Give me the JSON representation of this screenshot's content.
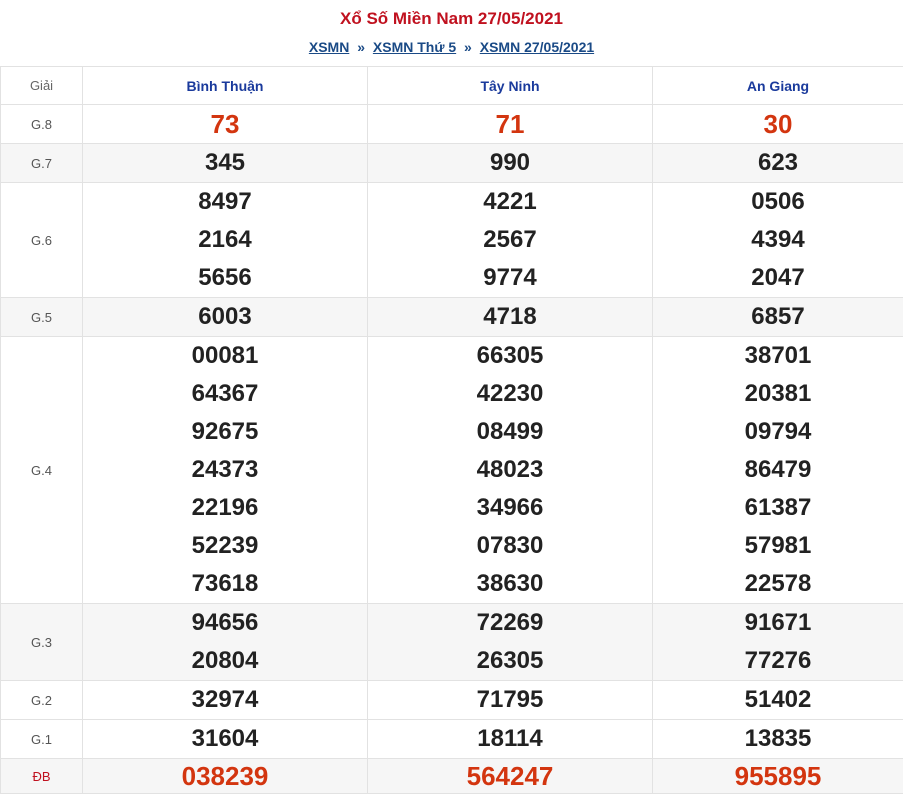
{
  "title": "Xổ Số Miền Nam 27/05/2021",
  "breadcrumb": {
    "items": [
      "XSMN",
      "XSMN Thứ 5",
      "XSMN 27/05/2021"
    ],
    "separator": "»"
  },
  "table": {
    "header": {
      "prize_label": "Giải",
      "provinces": [
        "Bình Thuận",
        "Tây Ninh",
        "An Giang"
      ]
    },
    "rows": [
      {
        "prize": "G.8",
        "values": [
          [
            "73"
          ],
          [
            "71"
          ],
          [
            "30"
          ]
        ]
      },
      {
        "prize": "G.7",
        "values": [
          [
            "345"
          ],
          [
            "990"
          ],
          [
            "623"
          ]
        ]
      },
      {
        "prize": "G.6",
        "values": [
          [
            "8497",
            "2164",
            "5656"
          ],
          [
            "4221",
            "2567",
            "9774"
          ],
          [
            "0506",
            "4394",
            "2047"
          ]
        ]
      },
      {
        "prize": "G.5",
        "values": [
          [
            "6003"
          ],
          [
            "4718"
          ],
          [
            "6857"
          ]
        ]
      },
      {
        "prize": "G.4",
        "values": [
          [
            "00081",
            "64367",
            "92675",
            "24373",
            "22196",
            "52239",
            "73618"
          ],
          [
            "66305",
            "42230",
            "08499",
            "48023",
            "34966",
            "07830",
            "38630"
          ],
          [
            "38701",
            "20381",
            "09794",
            "86479",
            "61387",
            "57981",
            "22578"
          ]
        ]
      },
      {
        "prize": "G.3",
        "values": [
          [
            "94656",
            "20804"
          ],
          [
            "72269",
            "26305"
          ],
          [
            "91671",
            "77276"
          ]
        ]
      },
      {
        "prize": "G.2",
        "values": [
          [
            "32974"
          ],
          [
            "71795"
          ],
          [
            "51402"
          ]
        ]
      },
      {
        "prize": "G.1",
        "values": [
          [
            "31604"
          ],
          [
            "18114"
          ],
          [
            "13835"
          ]
        ]
      },
      {
        "prize": "ĐB",
        "values": [
          [
            "038239"
          ],
          [
            "564247"
          ],
          [
            "955895"
          ]
        ]
      }
    ]
  },
  "colors": {
    "title": "#c0111f",
    "link": "#1a4a86",
    "header_text": "#1a3a9c",
    "highlight_number": "#d3350f",
    "alt_row": "#f6f6f6"
  }
}
